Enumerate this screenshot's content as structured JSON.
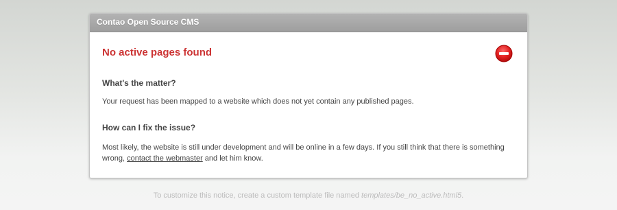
{
  "panel": {
    "header": "Contao Open Source CMS",
    "title": "No active pages found",
    "matter_heading": "What's the matter?",
    "matter_text": "Your request has been mapped to a website which does not yet contain any published pages.",
    "fix_heading": "How can I fix the issue?",
    "fix_text_before": "Most likely, the website is still under development and will be online in a few days. If you still think that there is something wrong, ",
    "fix_link": "contact the webmaster",
    "fix_text_after": " and let him know.",
    "status_icon": "stop-icon"
  },
  "footer": {
    "text_before": "To customize this notice, create a custom template file named ",
    "template_name": "templates/be_no_active.html5",
    "text_after": "."
  },
  "colors": {
    "title_red": "#cc3333",
    "header_gray": "#a8a8a8"
  }
}
